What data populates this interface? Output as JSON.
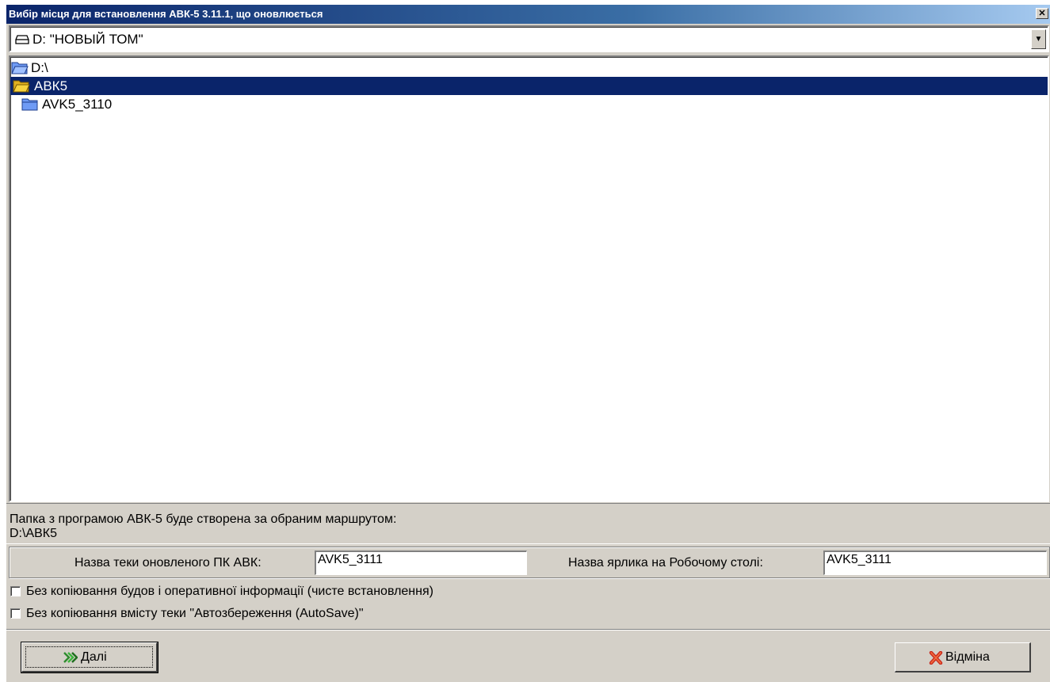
{
  "window": {
    "title": "Вибір місця для встановлення АВК-5 3.11.1, що оновлюється",
    "close_glyph": "✕"
  },
  "drive_combo": {
    "icon": "drive-icon",
    "value": "D: \"НОВЫЙ ТОМ\"",
    "arrow_glyph": "▼"
  },
  "folder_tree": {
    "items": [
      {
        "label": "D:\\",
        "icon": "open-folder-icon",
        "selected": false
      },
      {
        "label": "АВК5",
        "icon": "open-folder-icon",
        "selected": true
      },
      {
        "label": "AVK5_3110",
        "icon": "closed-folder-icon",
        "selected": false
      }
    ]
  },
  "path_info": {
    "line1": "Папка з програмою АВК-5 буде створена за обраним маршрутом:",
    "line2": "D:\\АВК5"
  },
  "names": {
    "folder_label": "Назва теки оновленого ПК АВК:",
    "folder_value": "AVK5_3111",
    "shortcut_label": "Назва ярлика на Робочому столі:",
    "shortcut_value": "AVK5_3111"
  },
  "options": {
    "clean_install_label": "Без копіювання будов і оперативної інформації (чисте встановлення)",
    "clean_install_checked": false,
    "no_autosave_label": "Без копіювання вмісту теки \"Автозбереження (AutoSave)\"",
    "no_autosave_checked": false
  },
  "buttons": {
    "next_label": "Далі",
    "next_icon": "double-chevron-right-icon",
    "cancel_label": "Відміна",
    "cancel_icon": "red-x-icon"
  },
  "colors": {
    "selection": "#0a246a",
    "folder_blue": "#6f9bf5",
    "folder_yellow": "#f7d23e",
    "panel": "#d4d0c8"
  }
}
